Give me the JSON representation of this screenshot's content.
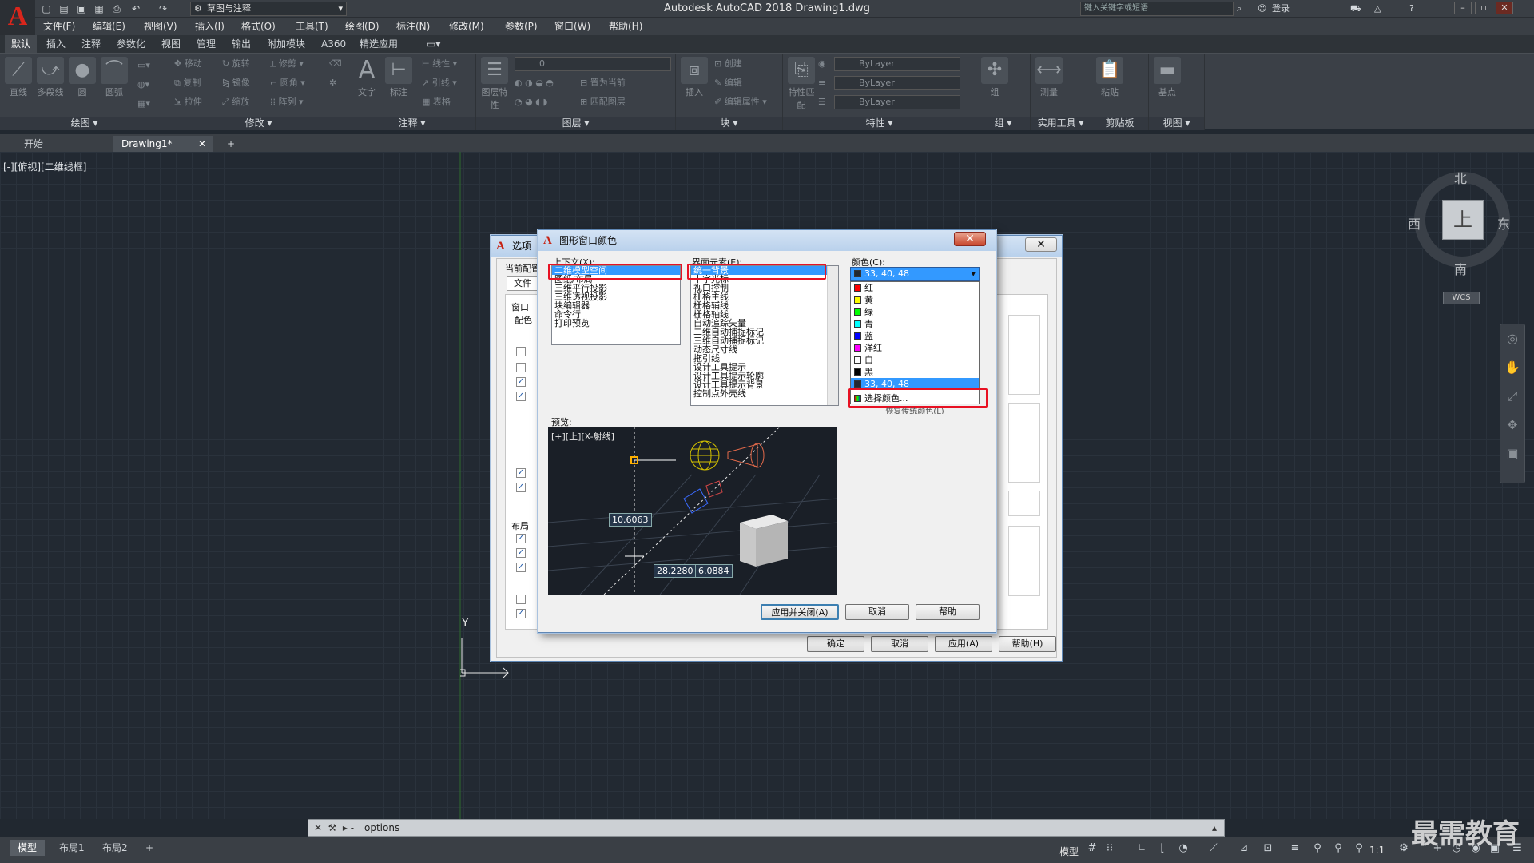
{
  "window": {
    "title": "Autodesk AutoCAD 2018    Drawing1.dwg",
    "workspace": "草图与注释",
    "search_placeholder": "键入关键字或短语",
    "login": "登录",
    "logo": "A"
  },
  "menu": [
    "文件(F)",
    "编辑(E)",
    "视图(V)",
    "插入(I)",
    "格式(O)",
    "工具(T)",
    "绘图(D)",
    "标注(N)",
    "修改(M)",
    "参数(P)",
    "窗口(W)",
    "帮助(H)"
  ],
  "ribbon_tabs": [
    "默认",
    "插入",
    "注释",
    "参数化",
    "视图",
    "管理",
    "输出",
    "附加模块",
    "A360",
    "精选应用"
  ],
  "ribbon": {
    "draw_tools": [
      "直线",
      "多段线",
      "圆",
      "圆弧"
    ],
    "draw_title": "绘图",
    "modify_tools": [
      "移动",
      "旋转",
      "修剪",
      "复制",
      "镜像",
      "圆角",
      "拉伸",
      "缩放",
      "阵列"
    ],
    "modify_title": "修改",
    "annotation_tools": [
      "文字",
      "标注",
      "线性",
      "引线",
      "表格"
    ],
    "annotation_title": "注释",
    "layer_tools": [
      "图层特性",
      "置为当前",
      "匹配图层"
    ],
    "layer_current": "0",
    "layer_title": "图层",
    "block_tools": [
      "插入",
      "创建",
      "编辑",
      "编辑属性"
    ],
    "block_title": "块",
    "props_tools": [
      "特性匹配"
    ],
    "props_values": [
      "ByLayer",
      "ByLayer",
      "ByLayer"
    ],
    "props_title": "特性",
    "group_tools": [
      "组"
    ],
    "group_title": "组",
    "util_tools": [
      "测量"
    ],
    "util_title": "实用工具",
    "clip_tools": [
      "粘贴"
    ],
    "clip_title": "剪贴板",
    "view_tools": [
      "基点"
    ],
    "view_title": "视图"
  },
  "doc_tabs": [
    "开始",
    "Drawing1*"
  ],
  "viewport_label": "[-][俯视][二维线框]",
  "viewcube": {
    "top": "上",
    "north": "北",
    "south": "南",
    "east": "东",
    "west": "西",
    "wcs": "WCS"
  },
  "ucs_label": "Y",
  "command_line": {
    "text": "_options",
    "prompt": "▸ -"
  },
  "layout_tabs": [
    "模型",
    "布局1",
    "布局2"
  ],
  "status": {
    "model": "模型",
    "scale": "1:1"
  },
  "watermark": "最需教育",
  "options_dialog": {
    "title": "选项",
    "current_profile": "当前配置",
    "file_tab": "文件",
    "window_group": "窗口",
    "config_label": "配色",
    "layout_group": "布局",
    "buttons": {
      "ok": "确定",
      "cancel": "取消",
      "apply": "应用(A)",
      "help": "帮助(H)"
    }
  },
  "color_dialog": {
    "title": "图形窗口颜色",
    "context_label": "上下文(X):",
    "context_items": [
      "二维模型空间",
      "图纸/布局",
      "三维平行投影",
      "三维透视投影",
      "块编辑器",
      "命令行",
      "打印预览"
    ],
    "element_label": "界面元素(E):",
    "element_items": [
      "统一背景",
      "十字光标",
      "视口控制",
      "栅格主线",
      "栅格辅线",
      "栅格轴线",
      "自动追踪矢量",
      "二维自动捕捉标记",
      "三维自动捕捉标记",
      "动态尺寸线",
      "拖引线",
      "设计工具提示",
      "设计工具提示轮廓",
      "设计工具提示背景",
      "控制点外壳线"
    ],
    "color_label": "颜色(C):",
    "color_current": "33, 40, 48",
    "color_options": [
      {
        "name": "红",
        "hex": "#ff0000"
      },
      {
        "name": "黄",
        "hex": "#ffff00"
      },
      {
        "name": "绿",
        "hex": "#00ff00"
      },
      {
        "name": "青",
        "hex": "#00ffff"
      },
      {
        "name": "蓝",
        "hex": "#0000ff"
      },
      {
        "name": "洋红",
        "hex": "#ff00ff"
      },
      {
        "name": "白",
        "hex": "#ffffff"
      },
      {
        "name": "黑",
        "hex": "#000000"
      },
      {
        "name": "33, 40, 48",
        "hex": "#212830"
      }
    ],
    "select_color": "选择颜色...",
    "restore_item": "恢复传统颜色(L)",
    "preview_label": "预览:",
    "preview_view": "[+][上][X-射线]",
    "preview_values": [
      "10.6063",
      "28.2280",
      "6.0884"
    ],
    "buttons": {
      "apply_close": "应用并关闭(A)",
      "cancel": "取消",
      "help": "帮助"
    }
  }
}
